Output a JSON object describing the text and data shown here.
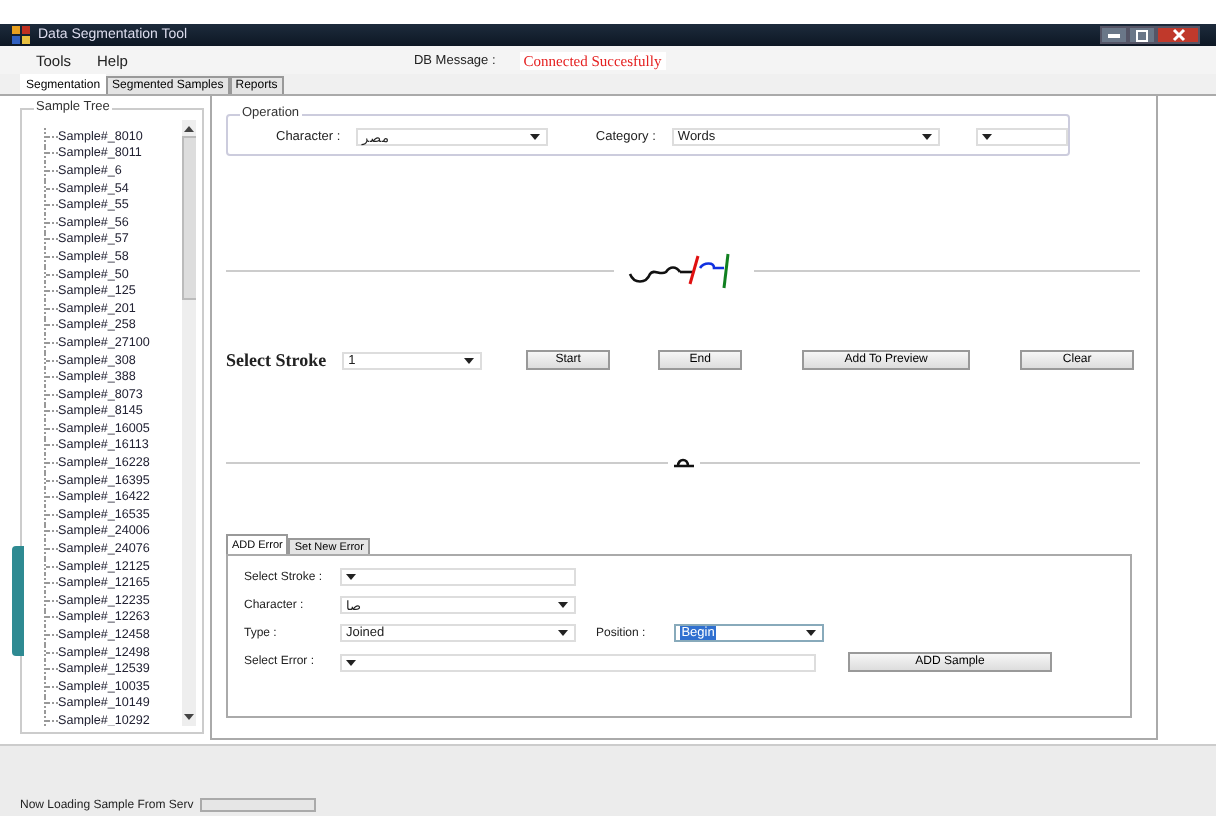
{
  "window": {
    "title": "Data Segmentation Tool"
  },
  "menu": [
    "Tools",
    "Help"
  ],
  "db_message": {
    "label": "DB Message :",
    "value": "Connected Succesfully"
  },
  "tabs": [
    {
      "label": "Segmentation",
      "selected": true
    },
    {
      "label": "Segmented Samples",
      "selected": false
    },
    {
      "label": "Reports",
      "selected": false
    }
  ],
  "sample_tree": {
    "title": "Sample Tree",
    "items": [
      "Sample#_8010",
      "Sample#_8011",
      "Sample#_6",
      "Sample#_54",
      "Sample#_55",
      "Sample#_56",
      "Sample#_57",
      "Sample#_58",
      "Sample#_50",
      "Sample#_125",
      "Sample#_201",
      "Sample#_258",
      "Sample#_27100",
      "Sample#_308",
      "Sample#_388",
      "Sample#_8073",
      "Sample#_8145",
      "Sample#_16005",
      "Sample#_16113",
      "Sample#_16228",
      "Sample#_16395",
      "Sample#_16422",
      "Sample#_16535",
      "Sample#_24006",
      "Sample#_24076",
      "Sample#_12125",
      "Sample#_12165",
      "Sample#_12235",
      "Sample#_12263",
      "Sample#_12458",
      "Sample#_12498",
      "Sample#_12539",
      "Sample#_10035",
      "Sample#_10149",
      "Sample#_10292"
    ]
  },
  "operation": {
    "title": "Operation",
    "character_label": "Character :",
    "character_value": "مصر",
    "category_label": "Category :",
    "category_value": "Words"
  },
  "select_stroke": {
    "label": "Select Stroke",
    "value": "1"
  },
  "buttons": [
    "Start",
    "End",
    "Add To Preview",
    "Clear"
  ],
  "error_tabs": [
    {
      "label": "ADD Error",
      "selected": true
    },
    {
      "label": "Set New Error",
      "selected": false
    }
  ],
  "error_form": {
    "stroke_label": "Select Stroke :",
    "character_label": "Character :",
    "character_value": "صا",
    "type_label": "Type :",
    "type_value": "Joined",
    "position_label": "Position :",
    "position_value": "Begin",
    "error_label": "Select Error :",
    "add_button": "ADD Sample"
  },
  "status_bar": {
    "text": "Now Loading Sample From Serv"
  }
}
